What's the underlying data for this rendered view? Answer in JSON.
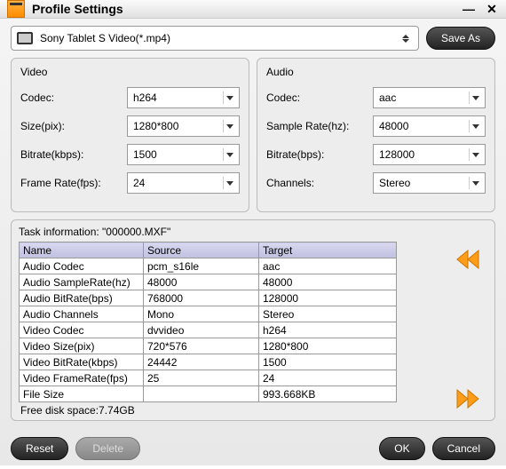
{
  "window": {
    "title": "Profile Settings"
  },
  "topbar": {
    "profile": "Sony Tablet S Video(*.mp4)",
    "save_as": "Save As"
  },
  "video": {
    "title": "Video",
    "codec_label": "Codec:",
    "codec": "h264",
    "size_label": "Size(pix):",
    "size": "1280*800",
    "bitrate_label": "Bitrate(kbps):",
    "bitrate": "1500",
    "framerate_label": "Frame Rate(fps):",
    "framerate": "24"
  },
  "audio": {
    "title": "Audio",
    "codec_label": "Codec:",
    "codec": "aac",
    "samplerate_label": "Sample Rate(hz):",
    "samplerate": "48000",
    "bitrate_label": "Bitrate(bps):",
    "bitrate": "128000",
    "channels_label": "Channels:",
    "channels": "Stereo"
  },
  "task": {
    "label": "Task information: \"000000.MXF\"",
    "headers": [
      "Name",
      "Source",
      "Target"
    ],
    "rows": [
      [
        "Audio Codec",
        "pcm_s16le",
        "aac"
      ],
      [
        "Audio SampleRate(hz)",
        "48000",
        "48000"
      ],
      [
        "Audio BitRate(bps)",
        "768000",
        "128000"
      ],
      [
        "Audio Channels",
        "Mono",
        "Stereo"
      ],
      [
        "Video Codec",
        "dvvideo",
        "h264"
      ],
      [
        "Video Size(pix)",
        "720*576",
        "1280*800"
      ],
      [
        "Video BitRate(kbps)",
        "24442",
        "1500"
      ],
      [
        "Video FrameRate(fps)",
        "25",
        "24"
      ],
      [
        "File Size",
        "",
        "993.668KB"
      ]
    ],
    "free_disk": "Free disk space:7.74GB"
  },
  "buttons": {
    "reset": "Reset",
    "delete": "Delete",
    "ok": "OK",
    "cancel": "Cancel"
  }
}
